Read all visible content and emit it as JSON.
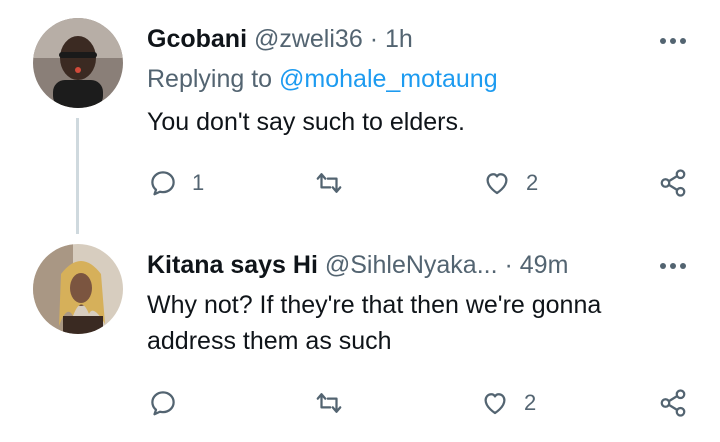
{
  "tweets": [
    {
      "name": "Gcobani",
      "handle": "@zweli36",
      "separator": "·",
      "time": "1h",
      "replying_prefix": "Replying to",
      "replying_to": "@mohale_motaung",
      "text": "You don't say such to elders.",
      "actions": {
        "reply_count": "1",
        "retweet_count": "",
        "like_count": "2"
      },
      "icons": [
        "reply-icon",
        "retweet-icon",
        "like-icon",
        "share-icon",
        "more-icon"
      ]
    },
    {
      "name": "Kitana says Hi",
      "handle": "@SihleNyaka...",
      "separator": "·",
      "time": "49m",
      "text_line1": "Why not? If they're that then we're gonna",
      "text_line2": "address them as such",
      "actions": {
        "reply_count": "",
        "retweet_count": "",
        "like_count": "2"
      },
      "icons": [
        "reply-icon",
        "retweet-icon",
        "like-icon",
        "share-icon",
        "more-icon"
      ]
    }
  ],
  "colors": {
    "text": "#0f1419",
    "secondary": "#536471",
    "link": "#1d9bf0",
    "thread_line": "#cfd9de"
  }
}
